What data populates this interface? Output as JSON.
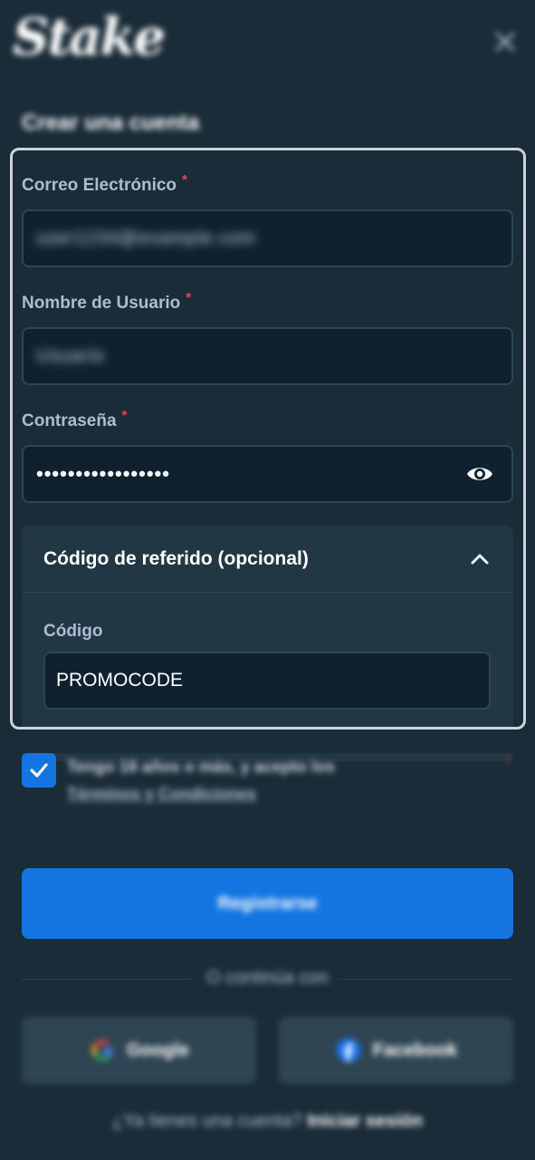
{
  "header": {
    "logo_text": "Stake",
    "title": "Crear una cuenta"
  },
  "form": {
    "email": {
      "label": "Correo Electrónico",
      "required_mark": "*",
      "value": "user1234@example.com"
    },
    "username": {
      "label": "Nombre de Usuario",
      "required_mark": "*",
      "value": "Usuario"
    },
    "password": {
      "label": "Contraseña",
      "required_mark": "*",
      "value": "•••••••••••••••••"
    },
    "referral": {
      "title": "Código de referido (opcional)",
      "code_label": "Código",
      "code_value": "PROMOCODE"
    }
  },
  "terms": {
    "checked": true,
    "text": "Tengo 18 años o más, y acepto los",
    "link": "Términos y Condiciones",
    "required_mark": "*"
  },
  "actions": {
    "register_label": "Registrarse",
    "divider_text": "O continúa con",
    "google_label": "Google",
    "facebook_label": "Facebook",
    "login_prompt": "¿Ya tienes una cuenta?",
    "login_link": "Iniciar sesión"
  },
  "colors": {
    "background": "#1a2c38",
    "input_bg": "#0f212e",
    "accent_blue": "#1475e1",
    "panel": "#213743",
    "required": "#ed4163"
  }
}
